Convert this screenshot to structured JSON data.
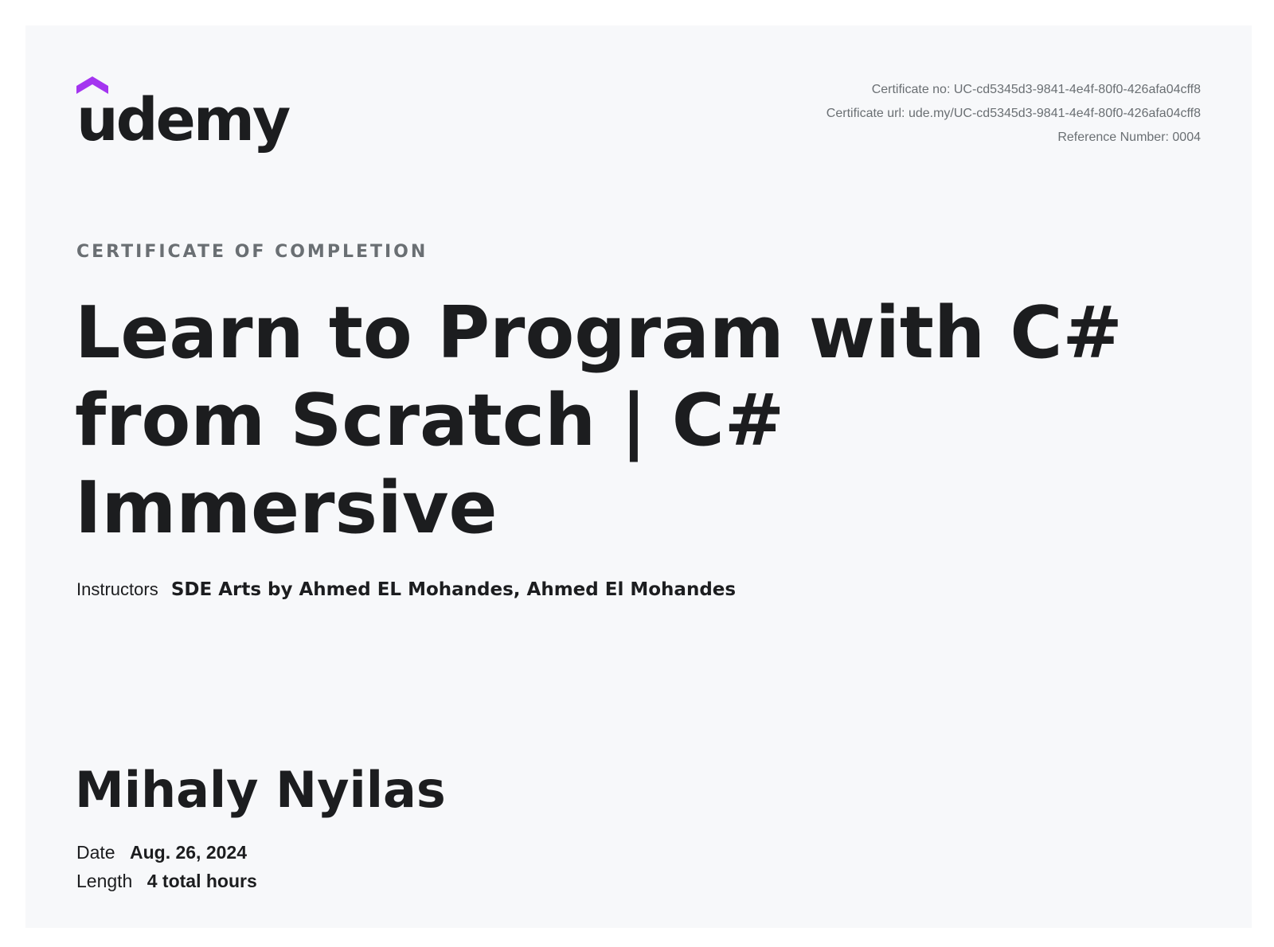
{
  "logo": {
    "wordmark": "udemy",
    "accent_color": "#a435f0"
  },
  "meta": {
    "certificate_no": "Certificate no: UC-cd5345d3-9841-4e4f-80f0-426afa04cff8",
    "certificate_url": "Certificate url: ude.my/UC-cd5345d3-9841-4e4f-80f0-426afa04cff8",
    "reference_number": "Reference Number: 0004"
  },
  "certificate": {
    "eyebrow": "CERTIFICATE OF COMPLETION",
    "course_title": "Learn to Program with C# from Scratch | C# Immersive",
    "instructors_label": "Instructors",
    "instructors": "SDE Arts by Ahmed EL Mohandes,  Ahmed El Mohandes",
    "recipient": "Mihaly Nyilas",
    "date_label": "Date",
    "date_value": "Aug. 26, 2024",
    "length_label": "Length",
    "length_value": "4 total hours"
  },
  "colors": {
    "text_primary": "#1c1d1f",
    "text_muted": "#6a6f73",
    "page_background": "#f7f8fa"
  }
}
